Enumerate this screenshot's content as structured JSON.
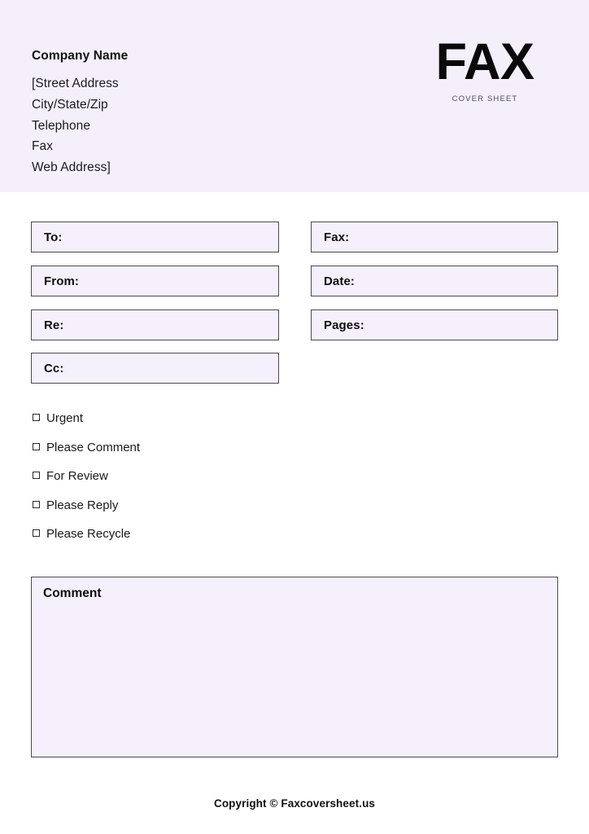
{
  "header": {
    "company_name": "Company Name",
    "address_lines": [
      "[Street Address",
      "City/State/Zip",
      "Telephone",
      "Fax",
      "Web Address]"
    ],
    "logo_title": "FAX",
    "logo_subtitle": "COVER SHEET"
  },
  "form": {
    "left_fields": [
      {
        "label": "To:",
        "value": ""
      },
      {
        "label": "From:",
        "value": ""
      },
      {
        "label": "Re:",
        "value": ""
      },
      {
        "label": "Cc:",
        "value": ""
      }
    ],
    "right_fields": [
      {
        "label": "Fax:",
        "value": ""
      },
      {
        "label": "Date:",
        "value": ""
      },
      {
        "label": "Pages:",
        "value": ""
      }
    ]
  },
  "checklist": {
    "checkbox_glyph": "square-outline-icon",
    "items": [
      {
        "label": "Urgent",
        "checked": false
      },
      {
        "label": "Please Comment",
        "checked": false
      },
      {
        "label": "For Review",
        "checked": false
      },
      {
        "label": "Please Reply",
        "checked": false
      },
      {
        "label": "Please Recycle",
        "checked": false
      }
    ]
  },
  "comment": {
    "label": "Comment",
    "value": ""
  },
  "footer": {
    "text": "Copyright © Faxcoversheet.us"
  },
  "colors": {
    "header_band": "#f4effb",
    "field_fill": "#f5f0fb",
    "field_border": "#4a4a52",
    "page_background": "#ffffff",
    "text_primary": "#111111",
    "text_muted": "#4b4b55"
  }
}
